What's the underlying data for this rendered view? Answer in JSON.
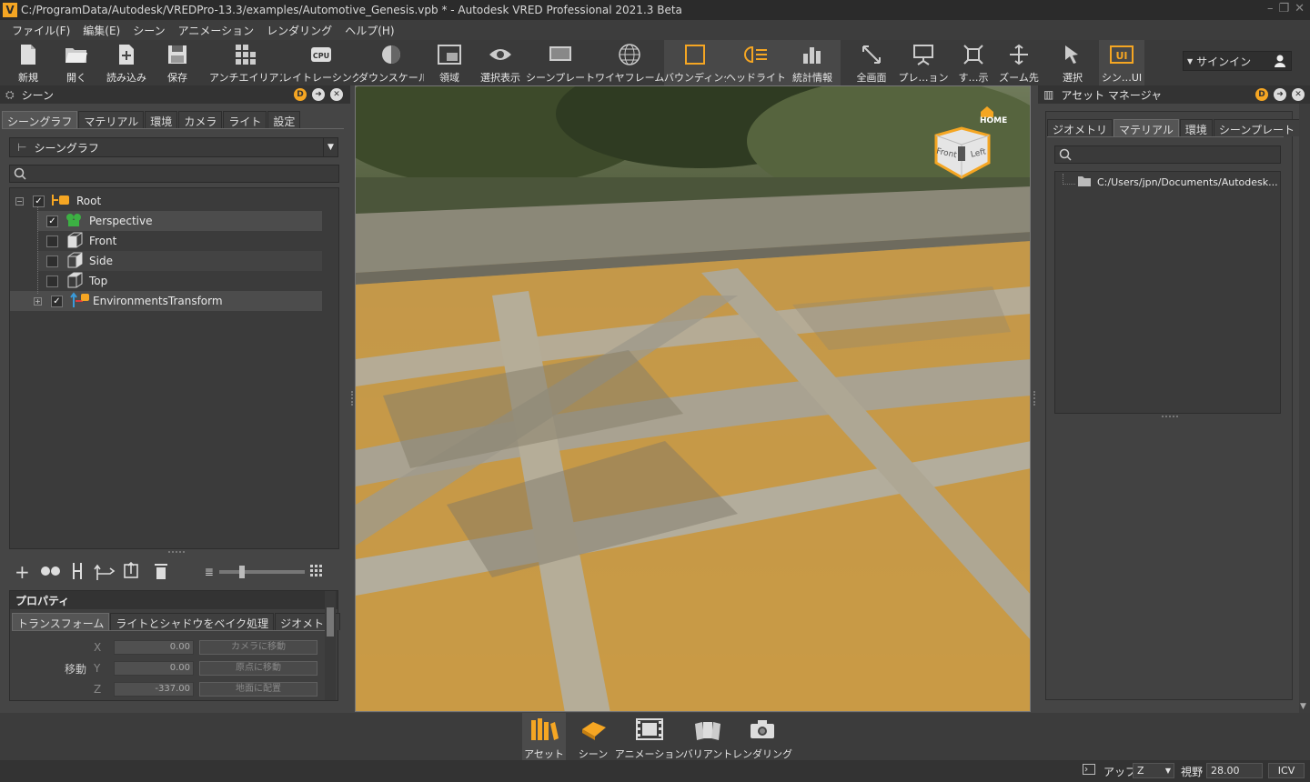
{
  "window": {
    "title": "C:/ProgramData/Autodesk/VREDPro-13.3/examples/Automotive_Genesis.vpb * - Autodesk VRED Professional 2021.3 Beta",
    "logo_text": "V"
  },
  "menubar": [
    "ファイル(F)",
    "編集(E)",
    "シーン",
    "アニメーション",
    "レンダリング",
    "ヘルプ(H)"
  ],
  "toolbar": {
    "buttons": [
      {
        "label": "新規",
        "icon": "new-file-icon"
      },
      {
        "label": "開く",
        "icon": "open-folder-icon"
      },
      {
        "label": "読み込み",
        "icon": "import-icon"
      },
      {
        "label": "保存",
        "icon": "save-icon"
      },
      {
        "label": "アンチエイリアス",
        "icon": "antialias-icon"
      },
      {
        "label": "レイトレーシング",
        "icon": "cpu-icon"
      },
      {
        "label": "ダウンスケール",
        "icon": "downscale-icon"
      },
      {
        "label": "領域",
        "icon": "region-icon"
      },
      {
        "label": "選択表示",
        "icon": "eye-icon"
      },
      {
        "label": "シーンプレート",
        "icon": "sceneplate-icon"
      },
      {
        "label": "ワイヤフレーム",
        "icon": "wireframe-globe-icon"
      },
      {
        "label": "バウンディング",
        "icon": "bounding-box-icon"
      },
      {
        "label": "ヘッドライト",
        "icon": "headlight-icon"
      },
      {
        "label": "統計情報",
        "icon": "statistics-icon"
      },
      {
        "label": "全画面",
        "icon": "fullscreen-icon"
      },
      {
        "label": "プレ…ョン",
        "icon": "presentation-icon"
      },
      {
        "label": "す…示",
        "icon": "show-all-icon"
      },
      {
        "label": "ズーム先",
        "icon": "zoom-to-icon"
      },
      {
        "label": "選択",
        "icon": "select-icon"
      },
      {
        "label": "シン…UI",
        "icon": "ui-icon"
      }
    ],
    "signin_label": "サインイン"
  },
  "scene_panel": {
    "title": "シーン",
    "tabs": [
      "シーングラフ",
      "マテリアル",
      "環境",
      "カメラ",
      "ライト",
      "設定"
    ],
    "dropdown_value": "シーングラフ",
    "search_placeholder": "",
    "tree": [
      {
        "label": "Root",
        "checked": true,
        "level": 0,
        "icon": "root-node-icon"
      },
      {
        "label": "Perspective",
        "checked": true,
        "level": 1,
        "icon": "perspective-camera-icon"
      },
      {
        "label": "Front",
        "checked": false,
        "level": 1,
        "icon": "camera-cube-icon"
      },
      {
        "label": "Side",
        "checked": false,
        "level": 1,
        "icon": "camera-cube-icon"
      },
      {
        "label": "Top",
        "checked": false,
        "level": 1,
        "icon": "camera-cube-icon"
      },
      {
        "label": "EnvironmentsTransform",
        "checked": true,
        "level": 1,
        "icon": "transform-node-icon"
      }
    ]
  },
  "properties": {
    "title": "プロパティ",
    "tabs": [
      "トランスフォーム",
      "ライトとシャドウをベイク処理",
      "ジオメトリ"
    ],
    "translate_label": "移動",
    "rows": [
      {
        "axis": "X",
        "value": "0.00",
        "action": "カメラに移動"
      },
      {
        "axis": "Y",
        "value": "0.00",
        "action": "原点に移動"
      },
      {
        "axis": "Z",
        "value": "-337.00",
        "action": "地面に配置"
      }
    ]
  },
  "viewcube": {
    "home_label": "HOME",
    "front_label": "Front",
    "left_label": "Left"
  },
  "asset_panel": {
    "title": "アセット マネージャ",
    "tabs": [
      "ジオメトリ",
      "マテリアル",
      "環境",
      "シーンプレート"
    ],
    "path": "C:/Users/jpn/Documents/Autodesk..."
  },
  "bottom_dock": [
    {
      "label": "アセット",
      "icon": "asset-books-icon"
    },
    {
      "label": "シーン",
      "icon": "scene-icon"
    },
    {
      "label": "アニメーション",
      "icon": "animation-film-icon"
    },
    {
      "label": "バリアント",
      "icon": "variant-icon"
    },
    {
      "label": "レンダリング",
      "icon": "camera-render-icon"
    }
  ],
  "statusbar": {
    "up_label": "アップ",
    "up_value": "Z",
    "fov_label": "視野",
    "fov_value": "28.00",
    "icv_label": "ICV"
  },
  "colors": {
    "accent": "#f5a623",
    "background": "#454545",
    "header": "#333333"
  }
}
